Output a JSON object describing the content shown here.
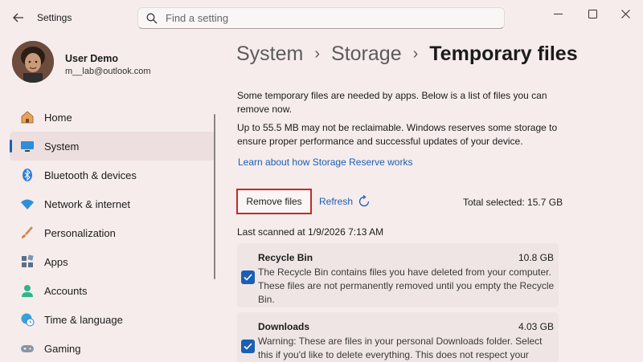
{
  "window": {
    "app_title": "Settings",
    "search_placeholder": "Find a setting"
  },
  "user": {
    "name": "User Demo",
    "email": "m__lab@outlook.com"
  },
  "sidebar": {
    "items": [
      {
        "label": "Home",
        "icon": "home-icon"
      },
      {
        "label": "System",
        "icon": "system-icon",
        "active": true
      },
      {
        "label": "Bluetooth & devices",
        "icon": "bluetooth-icon"
      },
      {
        "label": "Network & internet",
        "icon": "wifi-icon"
      },
      {
        "label": "Personalization",
        "icon": "brush-icon"
      },
      {
        "label": "Apps",
        "icon": "apps-icon"
      },
      {
        "label": "Accounts",
        "icon": "accounts-icon"
      },
      {
        "label": "Time & language",
        "icon": "globe-clock-icon"
      },
      {
        "label": "Gaming",
        "icon": "gamepad-icon"
      }
    ]
  },
  "breadcrumb": [
    "System",
    "Storage",
    "Temporary files"
  ],
  "main": {
    "intro": "Some temporary files are needed by apps. Below is a list of files you can remove now.",
    "reserve_note": "Up to 55.5 MB may not be reclaimable. Windows reserves some storage to ensure proper performance and successful updates of your device.",
    "learn_link": "Learn about how Storage Reserve works",
    "remove_button": "Remove files",
    "refresh_label": "Refresh",
    "total_selected": "Total selected: 15.7 GB",
    "last_scanned": "Last scanned at 1/9/2026 7:13 AM",
    "items": [
      {
        "title": "Recycle Bin",
        "size": "10.8 GB",
        "checked": true,
        "description": "The Recycle Bin contains files you have deleted from your computer. These files are not permanently removed until you empty the Recycle Bin."
      },
      {
        "title": "Downloads",
        "size": "4.03 GB",
        "checked": true,
        "description": "Warning: These are files in your personal Downloads folder. Select this if you'd like to delete everything. This does not respect your"
      }
    ]
  },
  "colors": {
    "background": "#f6ecec",
    "accent": "#1a5fb4",
    "highlight_border": "#c62828"
  }
}
